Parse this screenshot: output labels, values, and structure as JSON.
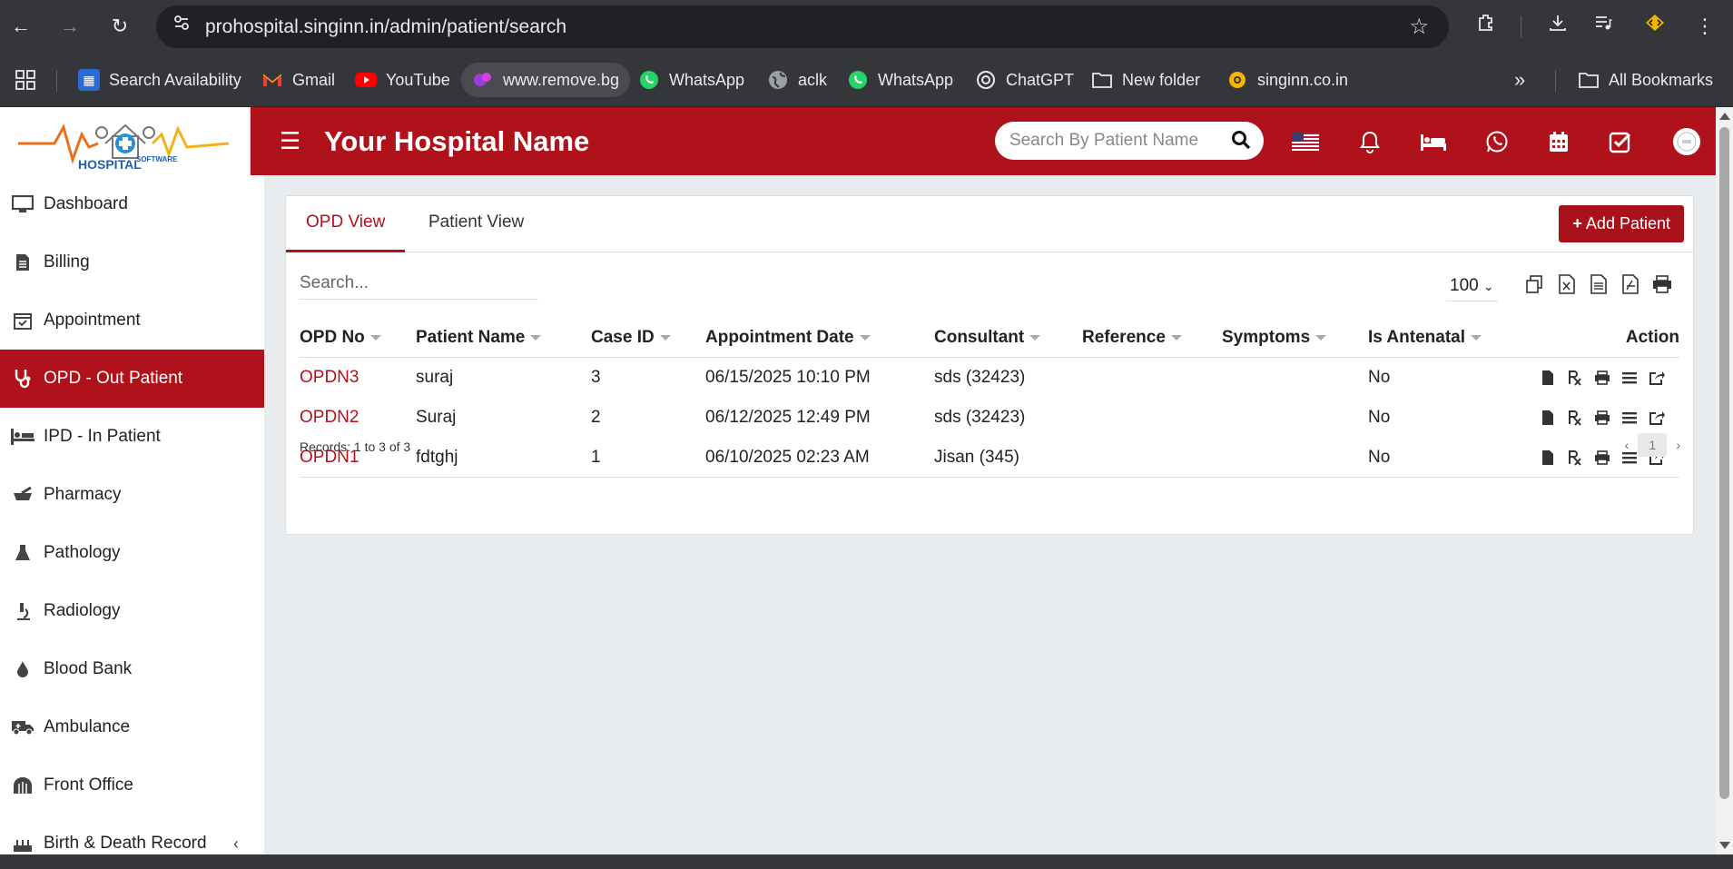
{
  "browser": {
    "url": "prohospital.singinn.in/admin/patient/search",
    "bookmarks": [
      {
        "label": "Search Availability",
        "icon": "availability-icon"
      },
      {
        "label": "Gmail",
        "icon": "gmail-icon"
      },
      {
        "label": "YouTube",
        "icon": "youtube-icon"
      },
      {
        "label": "www.remove.bg",
        "icon": "removebg-icon"
      },
      {
        "label": "WhatsApp",
        "icon": "whatsapp-icon"
      },
      {
        "label": "aclk",
        "icon": "globe-icon"
      },
      {
        "label": "WhatsApp",
        "icon": "whatsapp-icon"
      },
      {
        "label": "ChatGPT",
        "icon": "chatgpt-icon"
      },
      {
        "label": "New folder",
        "icon": "folder-icon"
      },
      {
        "label": "singinn.co.in",
        "icon": "singinn-icon"
      }
    ],
    "all_bookmarks": "All Bookmarks"
  },
  "header": {
    "logo_text": "HOSPITAL",
    "logo_subtext": "SOFTWARE",
    "hospital_name": "Your Hospital Name",
    "search_placeholder": "Search By Patient Name",
    "brand_color": "#b0121c"
  },
  "sidebar": {
    "items": [
      {
        "label": "Dashboard",
        "icon": "monitor-icon"
      },
      {
        "label": "Billing",
        "icon": "invoice-icon"
      },
      {
        "label": "Appointment",
        "icon": "calendar-check-icon"
      },
      {
        "label": "OPD - Out Patient",
        "icon": "stethoscope-icon",
        "active": true
      },
      {
        "label": "IPD - In Patient",
        "icon": "procedures-icon"
      },
      {
        "label": "Pharmacy",
        "icon": "mortar-pestle-icon"
      },
      {
        "label": "Pathology",
        "icon": "flask-icon"
      },
      {
        "label": "Radiology",
        "icon": "microscope-icon"
      },
      {
        "label": "Blood Bank",
        "icon": "drop-icon"
      },
      {
        "label": "Ambulance",
        "icon": "ambulance-icon"
      },
      {
        "label": "Front Office",
        "icon": "dungeon-icon"
      },
      {
        "label": "Birth & Death Record",
        "icon": "birthday-icon"
      }
    ]
  },
  "main": {
    "tabs": [
      "OPD View",
      "Patient View"
    ],
    "add_button": "Add Patient",
    "search_placeholder": "Search...",
    "per_page": "100",
    "columns": [
      "OPD No",
      "Patient Name",
      "Case ID",
      "Appointment Date",
      "Consultant",
      "Reference",
      "Symptoms",
      "Is Antenatal",
      "Action"
    ],
    "rows": [
      {
        "opd_no": "OPDN3",
        "patient_name": "suraj",
        "case_id": "3",
        "appointment_date": "06/15/2025 10:10 PM",
        "consultant": "sds (32423)",
        "reference": "",
        "symptoms": "",
        "is_antenatal": "No"
      },
      {
        "opd_no": "OPDN2",
        "patient_name": "Suraj",
        "case_id": "2",
        "appointment_date": "06/12/2025 12:49 PM",
        "consultant": "sds (32423)",
        "reference": "",
        "symptoms": "",
        "is_antenatal": "No"
      },
      {
        "opd_no": "OPDN1",
        "patient_name": "fdtghj",
        "case_id": "1",
        "appointment_date": "06/10/2025 02:23 AM",
        "consultant": "Jisan (345)",
        "reference": "",
        "symptoms": "",
        "is_antenatal": "No"
      }
    ],
    "records_text": "Records: 1 to 3 of 3",
    "current_page": "1"
  }
}
